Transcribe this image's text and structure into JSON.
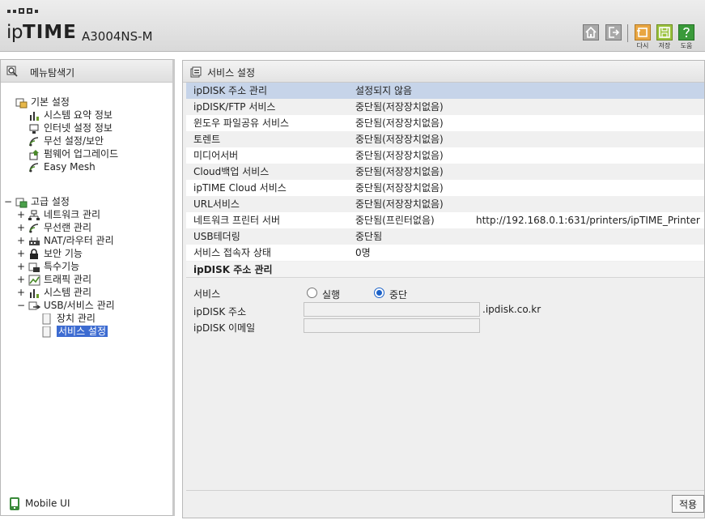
{
  "header": {
    "logo_ip": "ip",
    "logo_time": "TIME",
    "model": "A3004NS-M",
    "buttons": {
      "reload": "다시",
      "save": "저장",
      "help": "도움"
    }
  },
  "left": {
    "title": "메뉴탐색기",
    "basic": {
      "label": "기본 설정",
      "items": [
        "시스템 요약 정보",
        "인터넷 설정 정보",
        "무선 설정/보안",
        "펌웨어 업그레이드",
        "Easy Mesh"
      ]
    },
    "advanced": {
      "label": "고급 설정",
      "items": [
        "네트워크 관리",
        "무선랜 관리",
        "NAT/라우터 관리",
        "보안 기능",
        "특수기능",
        "트래픽 관리",
        "시스템 관리",
        "USB/서비스 관리"
      ],
      "usb_children": [
        "장치 관리",
        "서비스 설정"
      ]
    },
    "mobile": "Mobile UI"
  },
  "main": {
    "title": "서비스 설정",
    "services": [
      {
        "name": "ipDISK 주소 관리",
        "status": "설정되지 않음",
        "extra": ""
      },
      {
        "name": "ipDISK/FTP 서비스",
        "status": "중단됨(저장장치없음)",
        "extra": ""
      },
      {
        "name": "윈도우 파일공유 서비스",
        "status": "중단됨(저장장치없음)",
        "extra": ""
      },
      {
        "name": "토렌트",
        "status": "중단됨(저장장치없음)",
        "extra": ""
      },
      {
        "name": "미디어서버",
        "status": "중단됨(저장장치없음)",
        "extra": ""
      },
      {
        "name": "Cloud백업 서비스",
        "status": "중단됨(저장장치없음)",
        "extra": ""
      },
      {
        "name": "ipTIME Cloud 서비스",
        "status": "중단됨(저장장치없음)",
        "extra": ""
      },
      {
        "name": "URL서비스",
        "status": "중단됨(저장장치없음)",
        "extra": ""
      },
      {
        "name": "네트워크 프린터 서버",
        "status": "중단됨(프린터없음)",
        "extra": "http://192.168.0.1:631/printers/ipTIME_Printer"
      },
      {
        "name": "USB테더링",
        "status": "중단됨",
        "extra": ""
      },
      {
        "name": "서비스 접속자 상태",
        "status": "0명",
        "extra": ""
      }
    ],
    "ipdisk": {
      "section_title": "ipDISK 주소 관리",
      "service_label": "서비스",
      "run_label": "실행",
      "stop_label": "중단",
      "selected": "중단",
      "address_label": "ipDISK 주소",
      "address_value": "",
      "domain_suffix": ".ipdisk.co.kr",
      "email_label": "ipDISK 이메일",
      "email_value": ""
    },
    "apply_label": "적용"
  }
}
